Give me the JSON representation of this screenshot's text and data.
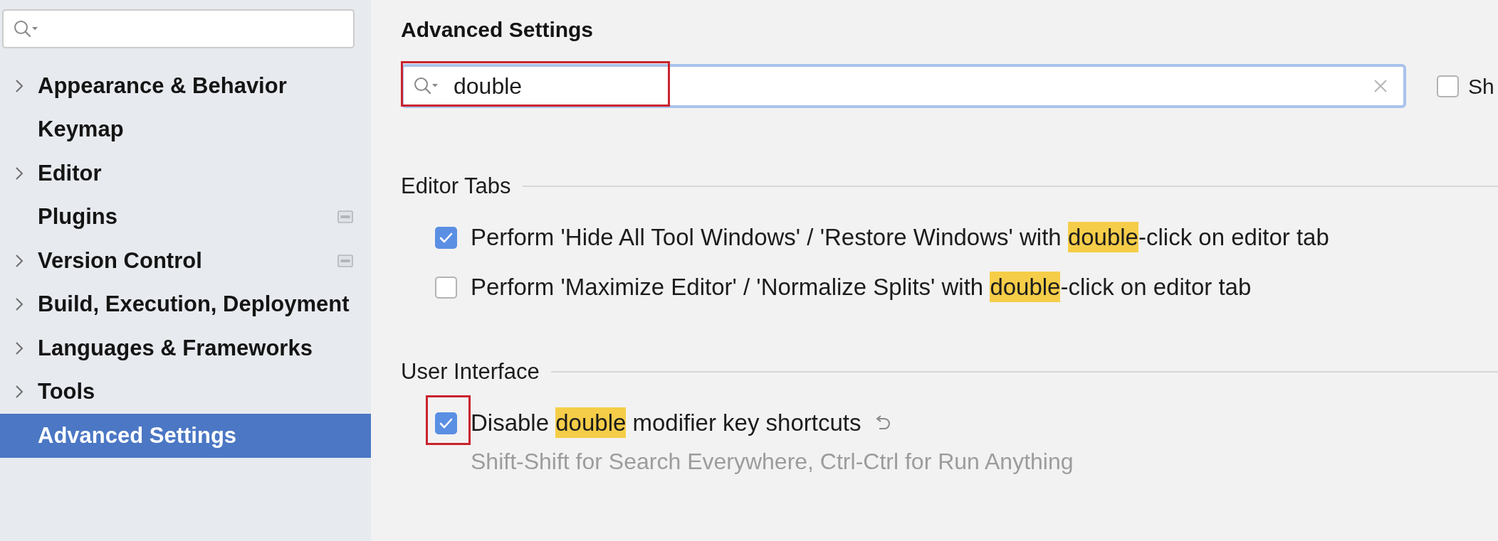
{
  "sidebar": {
    "items": [
      {
        "label": "Appearance & Behavior",
        "expandable": true,
        "badge": false,
        "selected": false
      },
      {
        "label": "Keymap",
        "expandable": false,
        "badge": false,
        "selected": false
      },
      {
        "label": "Editor",
        "expandable": true,
        "badge": false,
        "selected": false
      },
      {
        "label": "Plugins",
        "expandable": false,
        "badge": true,
        "selected": false
      },
      {
        "label": "Version Control",
        "expandable": true,
        "badge": true,
        "selected": false
      },
      {
        "label": "Build, Execution, Deployment",
        "expandable": true,
        "badge": false,
        "selected": false
      },
      {
        "label": "Languages & Frameworks",
        "expandable": true,
        "badge": false,
        "selected": false
      },
      {
        "label": "Tools",
        "expandable": true,
        "badge": false,
        "selected": false
      },
      {
        "label": "Advanced Settings",
        "expandable": false,
        "badge": false,
        "selected": true
      }
    ]
  },
  "page": {
    "title": "Advanced Settings",
    "search": {
      "value": "double",
      "annotated": true
    },
    "side_option": {
      "label": "Sh",
      "checked": false
    },
    "sections": [
      {
        "title": "Editor Tabs",
        "options": [
          {
            "label": {
              "before": "Perform 'Hide All Tool Windows' / 'Restore Windows' with ",
              "match": "double",
              "after": "-click on editor tab"
            },
            "checked": true,
            "annotated": false,
            "modified": false
          },
          {
            "label": {
              "before": "Perform 'Maximize Editor' / 'Normalize Splits' with ",
              "match": "double",
              "after": "-click on editor tab"
            },
            "checked": false,
            "annotated": false,
            "modified": false
          }
        ]
      },
      {
        "title": "User Interface",
        "options": [
          {
            "label": {
              "before": "Disable ",
              "match": "double",
              "after": " modifier key shortcuts"
            },
            "checked": true,
            "annotated": true,
            "modified": true,
            "description": "Shift-Shift for Search Everywhere, Ctrl-Ctrl for Run Anything"
          }
        ]
      }
    ]
  }
}
